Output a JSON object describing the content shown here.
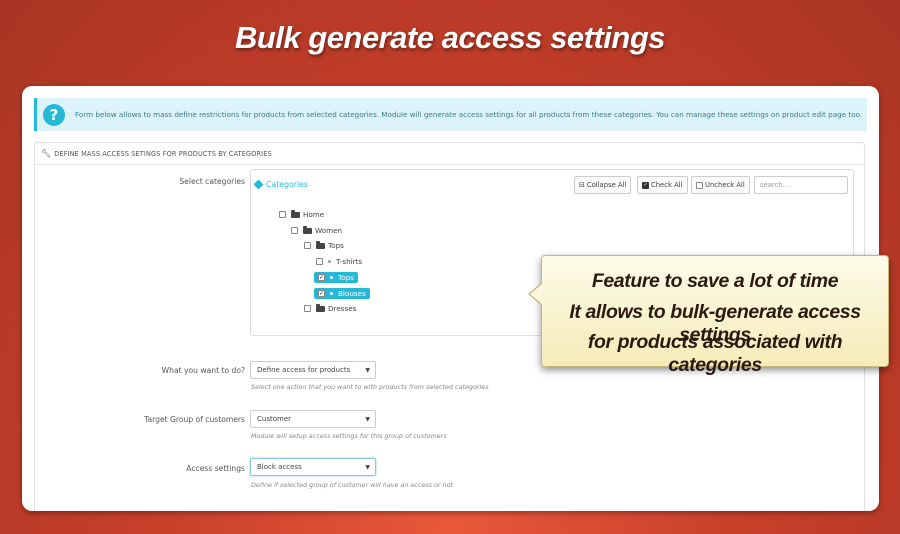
{
  "headline": "Bulk generate access settings",
  "info": {
    "icon": "question-icon",
    "text": "Form below allows to mass define restrictions for products from selected categories. Module will generate access settings for all products from these categories. You can manage these settings on product edit page too."
  },
  "panel": {
    "title": "DEFINE MASS ACCESS SETINGS FOR PRODUCTS BY CATEGORIES"
  },
  "categories": {
    "label": "Select categories",
    "title": "Categories",
    "collapse_all": "Collapse All",
    "check_all": "Check All",
    "uncheck_all": "Uncheck All",
    "search_placeholder": "search...",
    "tree": [
      {
        "label": "Home",
        "checked": false,
        "selected": false
      },
      {
        "label": "Women",
        "checked": false,
        "selected": false
      },
      {
        "label": "Tops",
        "checked": false,
        "selected": false
      },
      {
        "label": "T-shirts",
        "checked": false,
        "selected": false
      },
      {
        "label": "Tops",
        "checked": true,
        "selected": true
      },
      {
        "label": "Blouses",
        "checked": true,
        "selected": true
      },
      {
        "label": "Dresses",
        "checked": false,
        "selected": false
      }
    ]
  },
  "action": {
    "label": "What you want to do?",
    "value": "Define access for products",
    "help": "Select one action that you want to with products from selected categories"
  },
  "group": {
    "label": "Target Group of customers",
    "value": "Customer",
    "help": "Module will setup access settings for this group of customers"
  },
  "access": {
    "label": "Access settings",
    "value": "Block access",
    "help": "Define if selected group of customer will have an access or not"
  },
  "callout": {
    "line1": "Feature to save a lot of time",
    "line2": "It allows to bulk-generate access settings",
    "line3": "for products associated with categories"
  },
  "colors": {
    "background": "#c8402a",
    "accent": "#25b9d7",
    "callout": "#f5ecb8"
  }
}
